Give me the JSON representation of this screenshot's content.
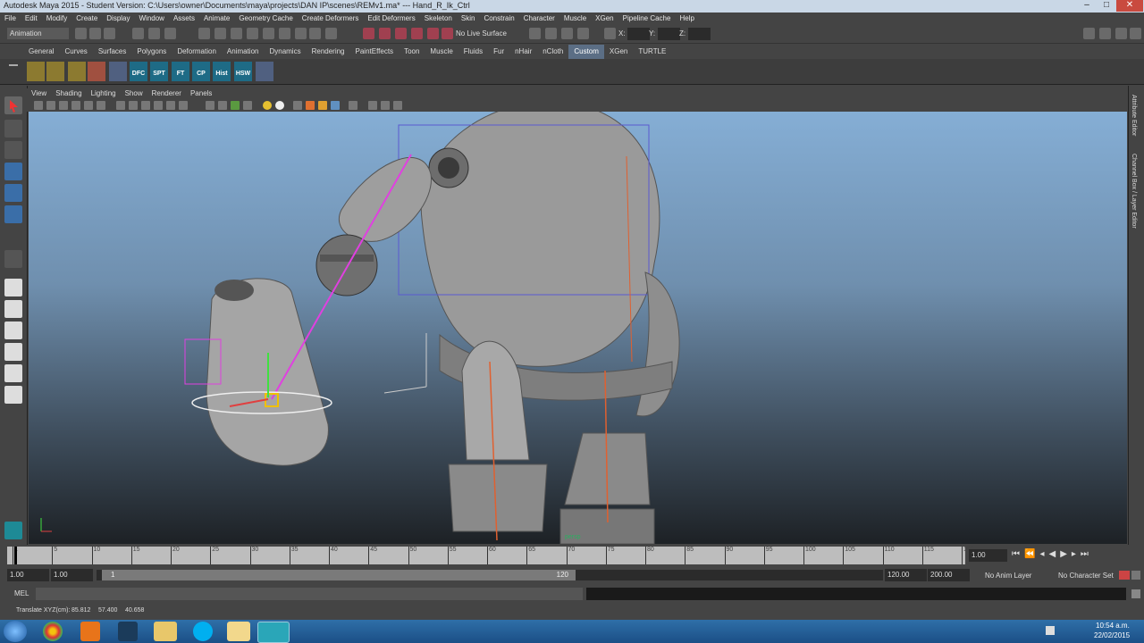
{
  "window": {
    "title": "Autodesk Maya 2015 - Student Version: C:\\Users\\owner\\Documents\\maya\\projects\\DAN IP\\scenes\\REMv1.ma* --- Hand_R_Ik_Ctrl"
  },
  "menubar": [
    "File",
    "Edit",
    "Modify",
    "Create",
    "Display",
    "Window",
    "Assets",
    "Animate",
    "Geometry Cache",
    "Create Deformers",
    "Edit Deformers",
    "Skeleton",
    "Skin",
    "Constrain",
    "Character",
    "Muscle",
    "XGen",
    "Pipeline Cache",
    "Help"
  ],
  "statusline": {
    "mode": "Animation",
    "live_surface": "No Live Surface",
    "x_label": "X:",
    "y_label": "Y:",
    "z_label": "Z:"
  },
  "shelf_tabs": [
    "General",
    "Curves",
    "Surfaces",
    "Polygons",
    "Deformation",
    "Animation",
    "Dynamics",
    "Rendering",
    "PaintEffects",
    "Toon",
    "Muscle",
    "Fluids",
    "Fur",
    "nHair",
    "nCloth",
    "Custom",
    "XGen",
    "TURTLE"
  ],
  "shelf_active": "Custom",
  "shelf_icons": [
    "DFC",
    "SPT",
    "FT",
    "CP",
    "Hist",
    "HSW"
  ],
  "panel_menu": [
    "View",
    "Shading",
    "Lighting",
    "Show",
    "Renderer",
    "Panels"
  ],
  "viewport": {
    "camera": "persp"
  },
  "right_strip": {
    "attr": "Attribute Editor",
    "channel": "Channel Box / Layer Editor"
  },
  "timeline": {
    "ticks": [
      "1",
      "5",
      "10",
      "15",
      "20",
      "25",
      "30",
      "35",
      "40",
      "45",
      "50",
      "55",
      "60",
      "65",
      "70",
      "75",
      "80",
      "85",
      "90",
      "95",
      "100",
      "105",
      "110",
      "115",
      "120"
    ],
    "current": "1.00"
  },
  "range": {
    "start": "1.00",
    "start2": "1.00",
    "slider_start": "1",
    "slider_end": "120",
    "end": "120.00",
    "end2": "200.00",
    "anim_layer": "No Anim Layer",
    "char_set": "No Character Set"
  },
  "mel": {
    "label": "MEL"
  },
  "helpline": {
    "label": "Translate XYZ(cm):",
    "x": "85.812",
    "y": "57.400",
    "z": "40.658"
  },
  "taskbar": {
    "time": "10:54 a.m.",
    "date": "22/02/2015"
  },
  "colors": {
    "accent": "#5b6e85",
    "taskbar": "#1b4f86"
  }
}
